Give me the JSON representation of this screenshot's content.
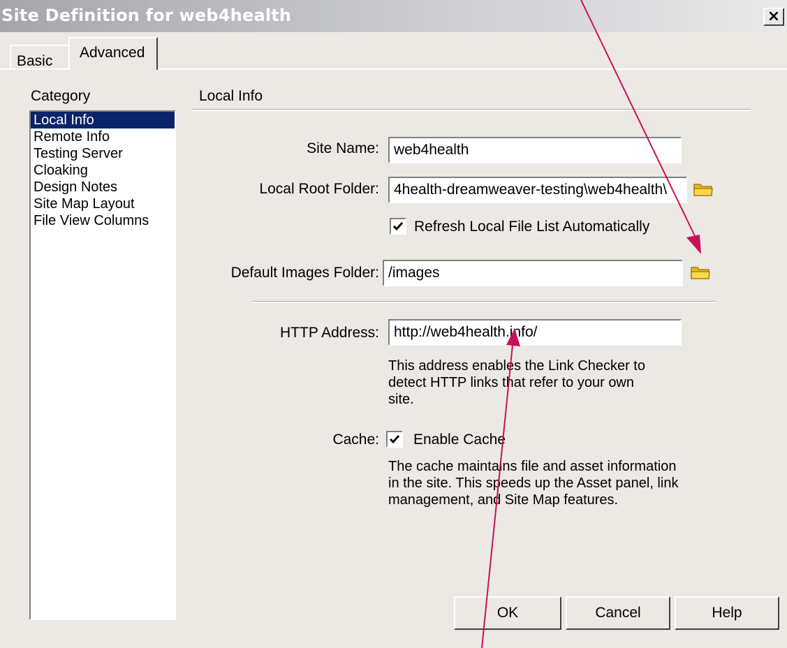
{
  "window": {
    "title": "Site Definition for web4health",
    "close_glyph": "×"
  },
  "tabs": [
    {
      "label": "Basic",
      "selected": false
    },
    {
      "label": "Advanced",
      "selected": true
    }
  ],
  "category": {
    "heading": "Category",
    "items": [
      "Local Info",
      "Remote Info",
      "Testing Server",
      "Cloaking",
      "Design Notes",
      "Site Map Layout",
      "File View Columns"
    ],
    "selected": "Local Info"
  },
  "panel": {
    "heading": "Local Info"
  },
  "fields": {
    "site_name": {
      "label": "Site Name:",
      "value": "web4health"
    },
    "local_root": {
      "label": "Local Root Folder:",
      "value": "4health-dreamweaver-testing\\web4health\\"
    },
    "refresh": {
      "label": "Refresh Local File List Automatically",
      "checked": true
    },
    "default_images": {
      "label": "Default Images Folder:",
      "value": "/images"
    },
    "http_address": {
      "label": "HTTP Address:",
      "value": "http://web4health.info/",
      "description": "This address enables the Link Checker to detect HTTP links that refer to your own site."
    },
    "cache": {
      "label": "Cache:",
      "checkbox_label": "Enable Cache",
      "checked": true,
      "description": "The cache maintains file and asset information in the site.  This speeds up the Asset panel, link management, and Site Map features."
    }
  },
  "buttons": {
    "ok": "OK",
    "cancel": "Cancel",
    "help": "Help"
  },
  "icons": {
    "folder": "folder-icon",
    "check": "checkmark-icon"
  },
  "colors": {
    "annotation_arrow": "#c8105a",
    "selection": "#0a246a",
    "dialog_bg": "#ece9e4"
  }
}
